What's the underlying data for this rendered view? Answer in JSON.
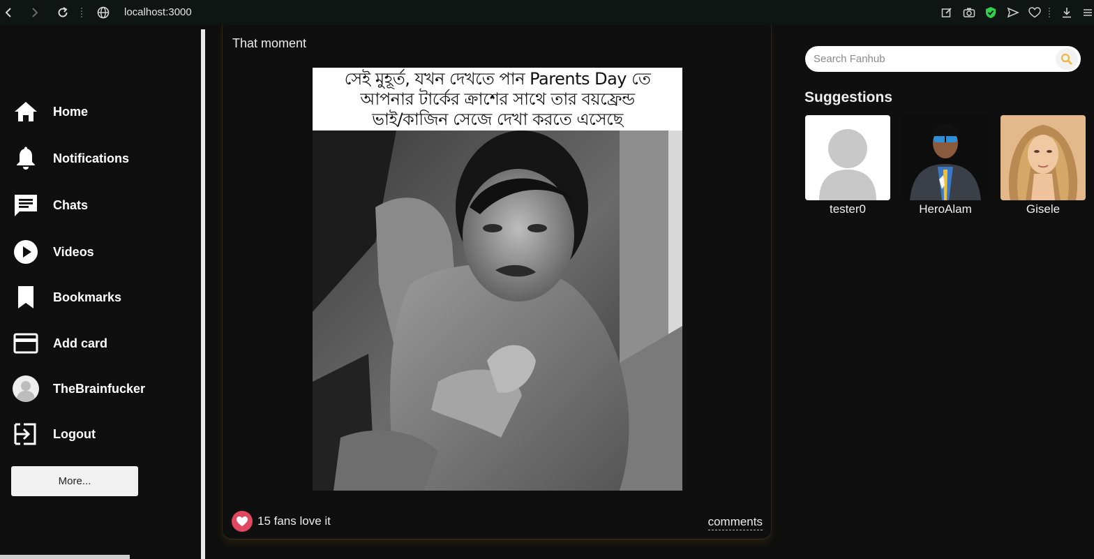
{
  "browser": {
    "url": "localhost:3000"
  },
  "sidebar": {
    "items": [
      {
        "label": "Home",
        "icon": "home-icon"
      },
      {
        "label": "Notifications",
        "icon": "bell-icon"
      },
      {
        "label": "Chats",
        "icon": "chat-icon"
      },
      {
        "label": "Videos",
        "icon": "play-icon"
      },
      {
        "label": "Bookmarks",
        "icon": "bookmark-icon"
      },
      {
        "label": "Add card",
        "icon": "credit-card-icon"
      },
      {
        "label": "TheBrainfucker",
        "icon": "avatar"
      },
      {
        "label": "Logout",
        "icon": "logout-icon"
      }
    ],
    "more_label": "More..."
  },
  "post": {
    "caption": "That moment",
    "meme_text": [
      "সেই মুহূর্ত, যখন দেখতে পান Parents Day তে",
      "আপনার টার্কের ক্রাশের সাথে তার বয়ফ্রেন্ড",
      "ভাই/কাজিন সেজে দেখা করতে এসেছে"
    ],
    "likes_text": "15 fans love it",
    "comments_label": "comments"
  },
  "search": {
    "placeholder": "Search Fanhub"
  },
  "suggestions": {
    "title": "Suggestions",
    "users": [
      {
        "name": "tester0"
      },
      {
        "name": "HeroAlam"
      },
      {
        "name": "Gisele"
      }
    ]
  },
  "colors": {
    "background": "#0e0f0e",
    "like": "#e0485f",
    "search_icon": "#f0b63a",
    "shield": "#2fd04c"
  }
}
